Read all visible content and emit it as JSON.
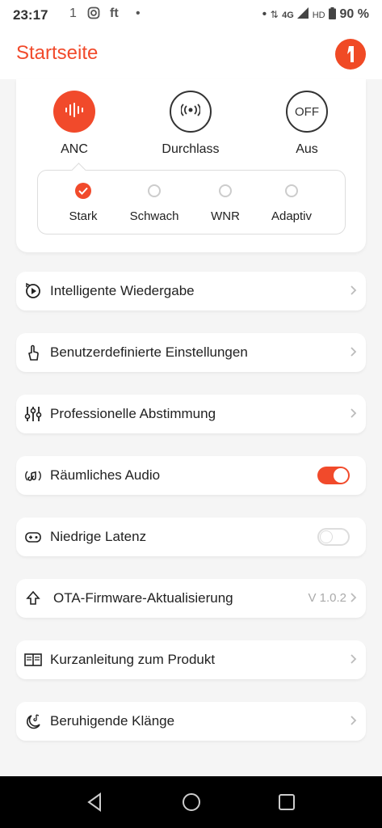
{
  "status_bar": {
    "time": "23:17",
    "notifications": [
      "1",
      "ft",
      "•"
    ],
    "signal": "4G",
    "hd": "HD",
    "battery": "90 %"
  },
  "header": {
    "title": "Startseite",
    "logo_icon": "brand-logo-icon"
  },
  "modes": [
    {
      "label": "ANC",
      "icon": "anc-waveform-icon",
      "active": true
    },
    {
      "label": "Durchlass",
      "icon": "transparency-icon",
      "active": false
    },
    {
      "label": "Aus",
      "icon_text": "OFF",
      "active": false
    }
  ],
  "anc_levels": [
    {
      "label": "Stark",
      "selected": true
    },
    {
      "label": "Schwach",
      "selected": false
    },
    {
      "label": "WNR",
      "selected": false
    },
    {
      "label": "Adaptiv",
      "selected": false
    }
  ],
  "menu": [
    {
      "label": "Intelligente Wiedergabe",
      "icon": "smart-play-icon",
      "control": "chevron"
    },
    {
      "label": "Benutzerdefinierte Einstellungen",
      "icon": "touch-gesture-icon",
      "control": "chevron"
    },
    {
      "label": "Professionelle Abstimmung",
      "icon": "equalizer-icon",
      "control": "chevron"
    },
    {
      "label": "Räumliches Audio",
      "icon": "spatial-audio-icon",
      "control": "toggle",
      "on": true
    },
    {
      "label": "Niedrige Latenz",
      "icon": "gamepad-icon",
      "control": "toggle",
      "on": false
    },
    {
      "label": "OTA-Firmware-Aktualisierung",
      "icon": "upload-arrow-icon",
      "control": "chevron",
      "value": "V 1.0.2"
    },
    {
      "label": "Kurzanleitung zum Produkt",
      "icon": "book-icon",
      "control": "chevron"
    },
    {
      "label": "Beruhigende Klänge",
      "icon": "moon-music-icon",
      "control": "chevron"
    }
  ],
  "colors": {
    "accent": "#f14a2b",
    "background": "#f5f5f5"
  }
}
